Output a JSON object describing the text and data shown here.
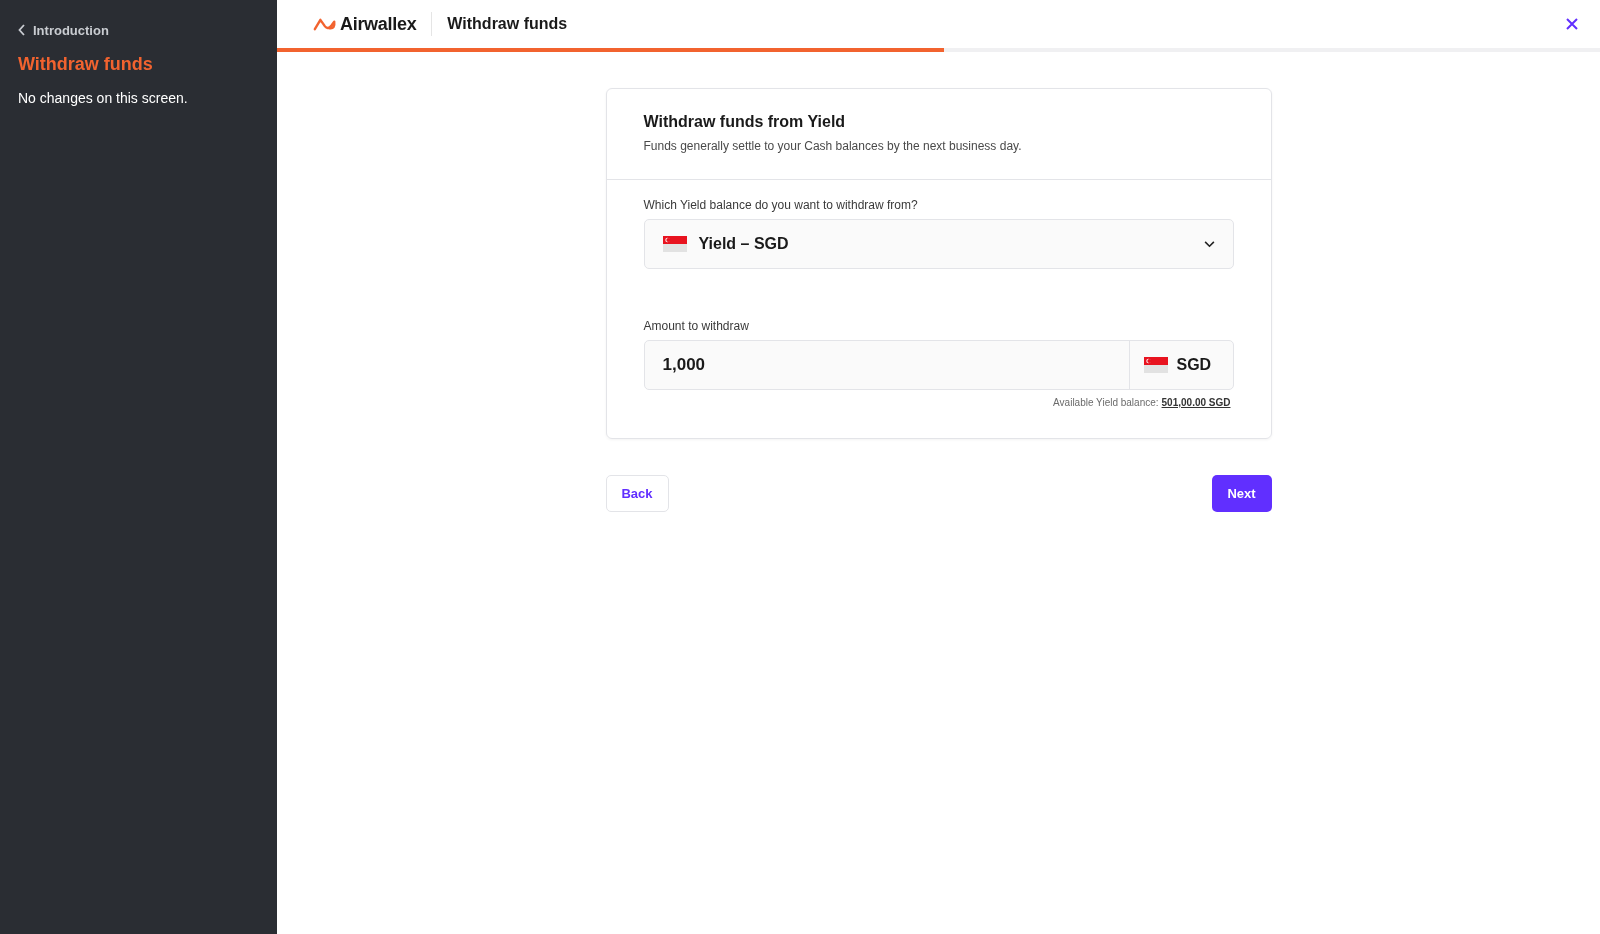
{
  "sidebar": {
    "back_link": "Introduction",
    "title": "Withdraw funds",
    "note": "No changes on this screen."
  },
  "header": {
    "brand": "Airwallex",
    "title": "Withdraw funds",
    "progress": {
      "level": 0.504
    }
  },
  "card": {
    "title": "Withdraw funds from Yield",
    "subtitle": "Funds generally settle to your Cash balances by the next business day.",
    "balance_select": {
      "label": "Which Yield balance do you want to withdraw from?",
      "value": "Yield – SGD"
    },
    "amount": {
      "label": "Amount to withdraw",
      "value": "1,000",
      "currency": "SGD",
      "available_label": "Available Yield balance:",
      "available_value": "501,00.00 SGD"
    }
  },
  "buttons": {
    "back": "Back",
    "next": "Next"
  }
}
